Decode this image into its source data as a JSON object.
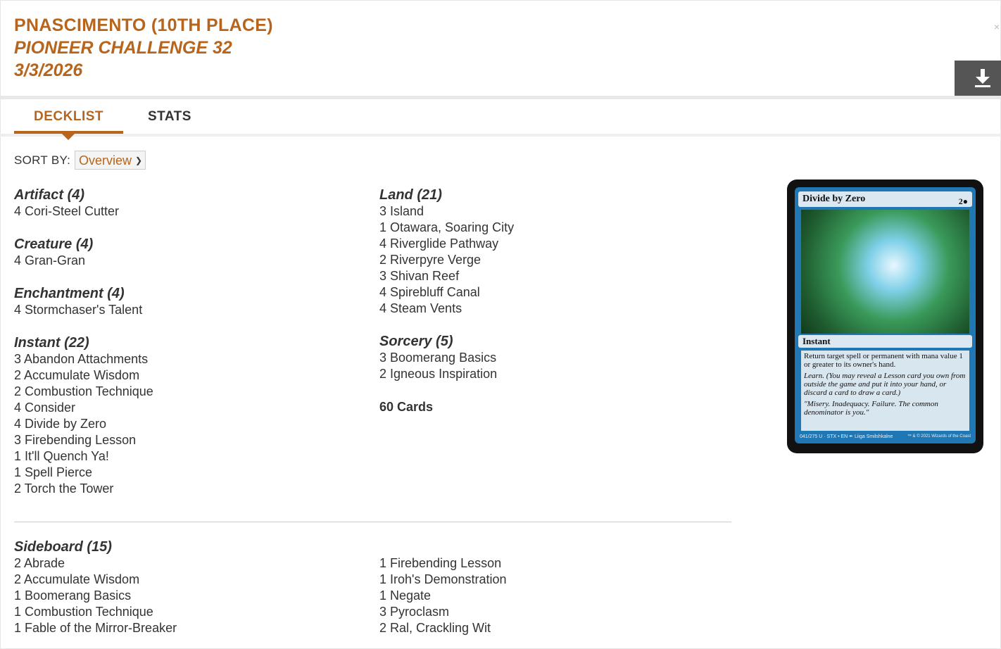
{
  "header": {
    "player": "PNASCIMENTO (10TH PLACE)",
    "event": "PIONEER CHALLENGE 32",
    "date": "3/3/2026"
  },
  "tabs": [
    {
      "label": "DECKLIST",
      "active": true
    },
    {
      "label": "STATS",
      "active": false
    }
  ],
  "sort": {
    "label": "SORT BY:",
    "selected": "Overview"
  },
  "left_column": [
    {
      "heading": "Artifact (4)",
      "cards": [
        "4 Cori-Steel Cutter"
      ]
    },
    {
      "heading": "Creature (4)",
      "cards": [
        "4 Gran-Gran"
      ]
    },
    {
      "heading": "Enchantment (4)",
      "cards": [
        "4 Stormchaser's Talent"
      ]
    },
    {
      "heading": "Instant (22)",
      "cards": [
        "3 Abandon Attachments",
        "2 Accumulate Wisdom",
        "2 Combustion Technique",
        "4 Consider",
        "4 Divide by Zero",
        "3 Firebending Lesson",
        "1 It'll Quench Ya!",
        "1 Spell Pierce",
        "2 Torch the Tower"
      ]
    }
  ],
  "right_column": [
    {
      "heading": "Land (21)",
      "cards": [
        "3 Island",
        "1 Otawara, Soaring City",
        "4 Riverglide Pathway",
        "2 Riverpyre Verge",
        "3 Shivan Reef",
        "4 Spirebluff Canal",
        "4 Steam Vents"
      ]
    },
    {
      "heading": "Sorcery (5)",
      "cards": [
        "3 Boomerang Basics",
        "2 Igneous Inspiration"
      ]
    }
  ],
  "total": "60 Cards",
  "sideboard": {
    "heading": "Sideboard (15)",
    "left": [
      "2 Abrade",
      "2 Accumulate Wisdom",
      "1 Boomerang Basics",
      "1 Combustion Technique",
      "1 Fable of the Mirror-Breaker"
    ],
    "right": [
      "1 Firebending Lesson",
      "1 Iroh's Demonstration",
      "1 Negate",
      "3 Pyroclasm",
      "2 Ral, Crackling Wit"
    ]
  },
  "card_preview": {
    "name": "Divide by Zero",
    "cost": "2●",
    "type": "Instant",
    "rules": "Return target spell or permanent with mana value 1 or greater to its owner's hand.",
    "learn": "Learn. (You may reveal a Lesson card you own from outside the game and put it into your hand, or discard a card to draw a card.)",
    "flavor": "\"Misery. Inadequacy. Failure. The common denominator is you.\"",
    "footer_left": "041/275 U · STX • EN ✒ Liiga Smilshkalne",
    "footer_right": "™ & © 2021 Wizards of the Coast"
  }
}
